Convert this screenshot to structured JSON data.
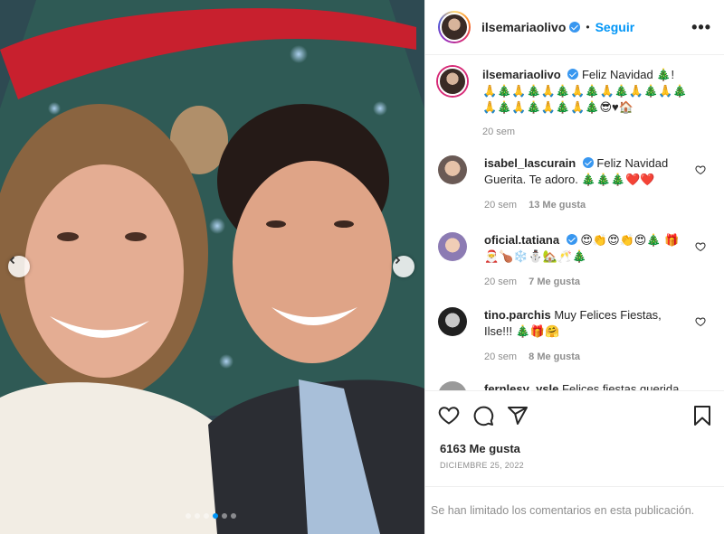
{
  "post": {
    "author": "ilsemariaolivo",
    "separator": "•",
    "follow_label": "Seguir",
    "more_label": "•••",
    "caption": "Feliz Navidad 🎄! 🙏🎄🙏🎄🙏🎄🙏🎄🙏🎄🙏🎄🙏🎄🙏🎄🙏🎄🙏🎄🙏🎄😎♥🏠",
    "caption_age": "20 sem",
    "likes": "6163 Me gusta",
    "date": "DICIEMBRE 25, 2022",
    "comments_limited": "Se han limitado los comentarios en esta publicación.",
    "carousel": {
      "count": 6,
      "active_index": 3
    }
  },
  "comments": [
    {
      "username": "isabel_lascurain",
      "verified": true,
      "text": "Feliz Navidad Guerita. Te adoro. 🎄🎄🎄❤️❤️",
      "age": "20 sem",
      "likes": "13 Me gusta"
    },
    {
      "username": "oficial.tatiana",
      "verified": true,
      "text": "😍👏😍👏😍🎄 🎁🎅🍗❄️⛄🏡🥂🎄",
      "age": "20 sem",
      "likes": "7 Me gusta"
    },
    {
      "username": "tino.parchis",
      "verified": false,
      "text": "Muy Felices Fiestas, Ilse!!! 🎄🎁🤗",
      "age": "20 sem",
      "likes": "8 Me gusta"
    },
    {
      "username": "fernlesv_ysle",
      "verified": false,
      "text": "Felices fiestas querida",
      "age": "",
      "likes": ""
    }
  ],
  "colors": {
    "accent": "#0095f6",
    "verified": "#3897f0",
    "muted": "#8e8e8e"
  },
  "icons": [
    "chevron-left-icon",
    "chevron-right-icon",
    "heart-icon",
    "comment-icon",
    "share-icon",
    "bookmark-icon",
    "verified-icon"
  ]
}
